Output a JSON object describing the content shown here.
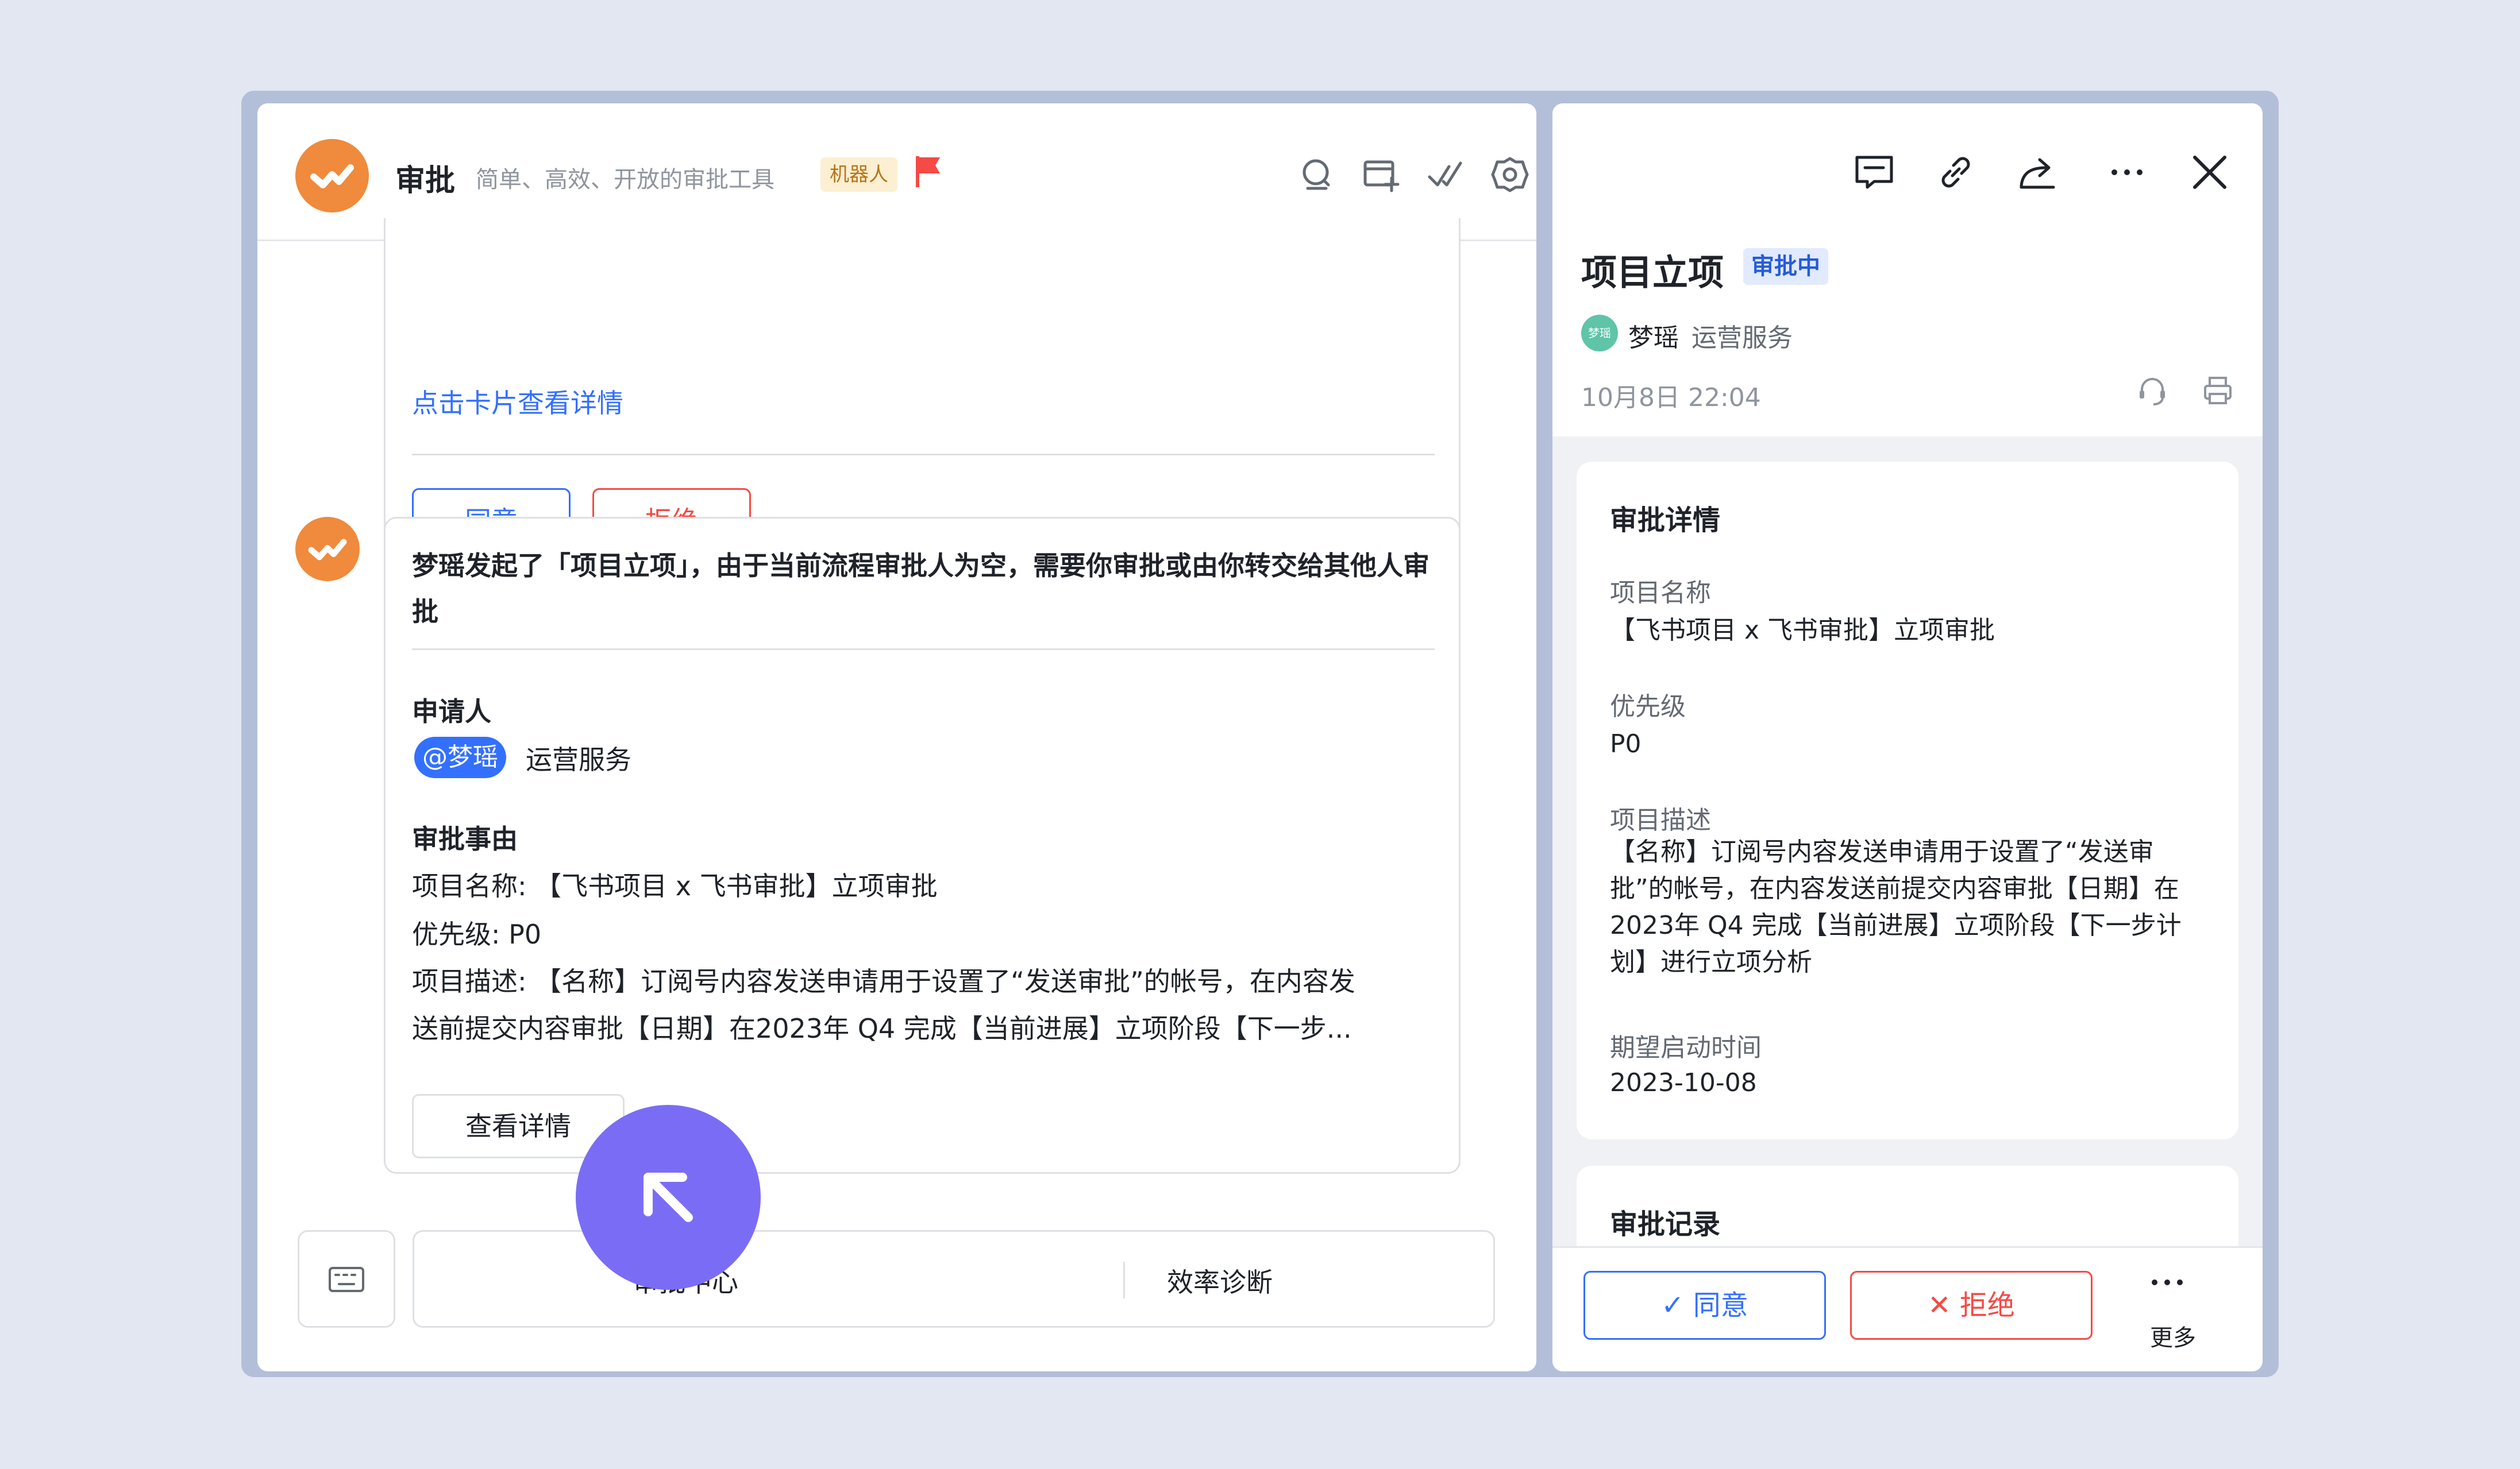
{
  "chat": {
    "title": "审批",
    "subtitle": "简单、高效、开放的审批工具",
    "bot_tag": "机器人",
    "colors": {
      "brand_orange": "#f08a3c",
      "accent_blue": "#3370ff",
      "danger_red": "#f54a45"
    },
    "header_icons": [
      "search-icon",
      "add-card-icon",
      "double-check-icon",
      "settings-icon"
    ],
    "card1": {
      "link": "点击卡片查看详情",
      "agree": "同意",
      "reject": "拒绝"
    },
    "card2": {
      "title": "梦瑶发起了「项目立项」，由于当前流程审批人为空，需要你审批或由你转交给其他人审批",
      "applicant_label": "申请人",
      "mention": "@梦瑶",
      "dept": "运营服务",
      "reason_label": "审批事由",
      "lines": [
        "项目名称: 【飞书项目 x 飞书审批】立项审批",
        "优先级: P0",
        "项目描述: 【名称】订阅号内容发送申请用于设置了“发送审批”的帐号，在内容发",
        "送前提交内容审批【日期】在2023年 Q4 完成【当前进展】立项阶段【下一步..."
      ],
      "view_button": "查看详情"
    },
    "quick_bar": {
      "item1": "审批中心",
      "item2": "效率诊断"
    }
  },
  "detail": {
    "title": "项目立项",
    "status": "审批中",
    "avatar_text": "梦瑶",
    "user": "梦瑶",
    "dept": "运营服务",
    "time": "10月8日 22:04",
    "section_details": "审批详情",
    "fields": [
      {
        "label": "项目名称",
        "value": "【飞书项目 x 飞书审批】立项审批"
      },
      {
        "label": "优先级",
        "value": "P0"
      },
      {
        "label": "项目描述",
        "value": "【名称】订阅号内容发送申请用于设置了“发送审批”的帐号，在内容发送前提交内容审批【日期】在2023年 Q4 完成【当前进展】立项阶段【下一步计划】进行立项分析"
      },
      {
        "label": "期望启动时间",
        "value": "2023-10-08"
      }
    ],
    "section_records": "审批记录",
    "footer": {
      "agree": "同意",
      "reject": "拒绝",
      "more": "更多"
    }
  }
}
